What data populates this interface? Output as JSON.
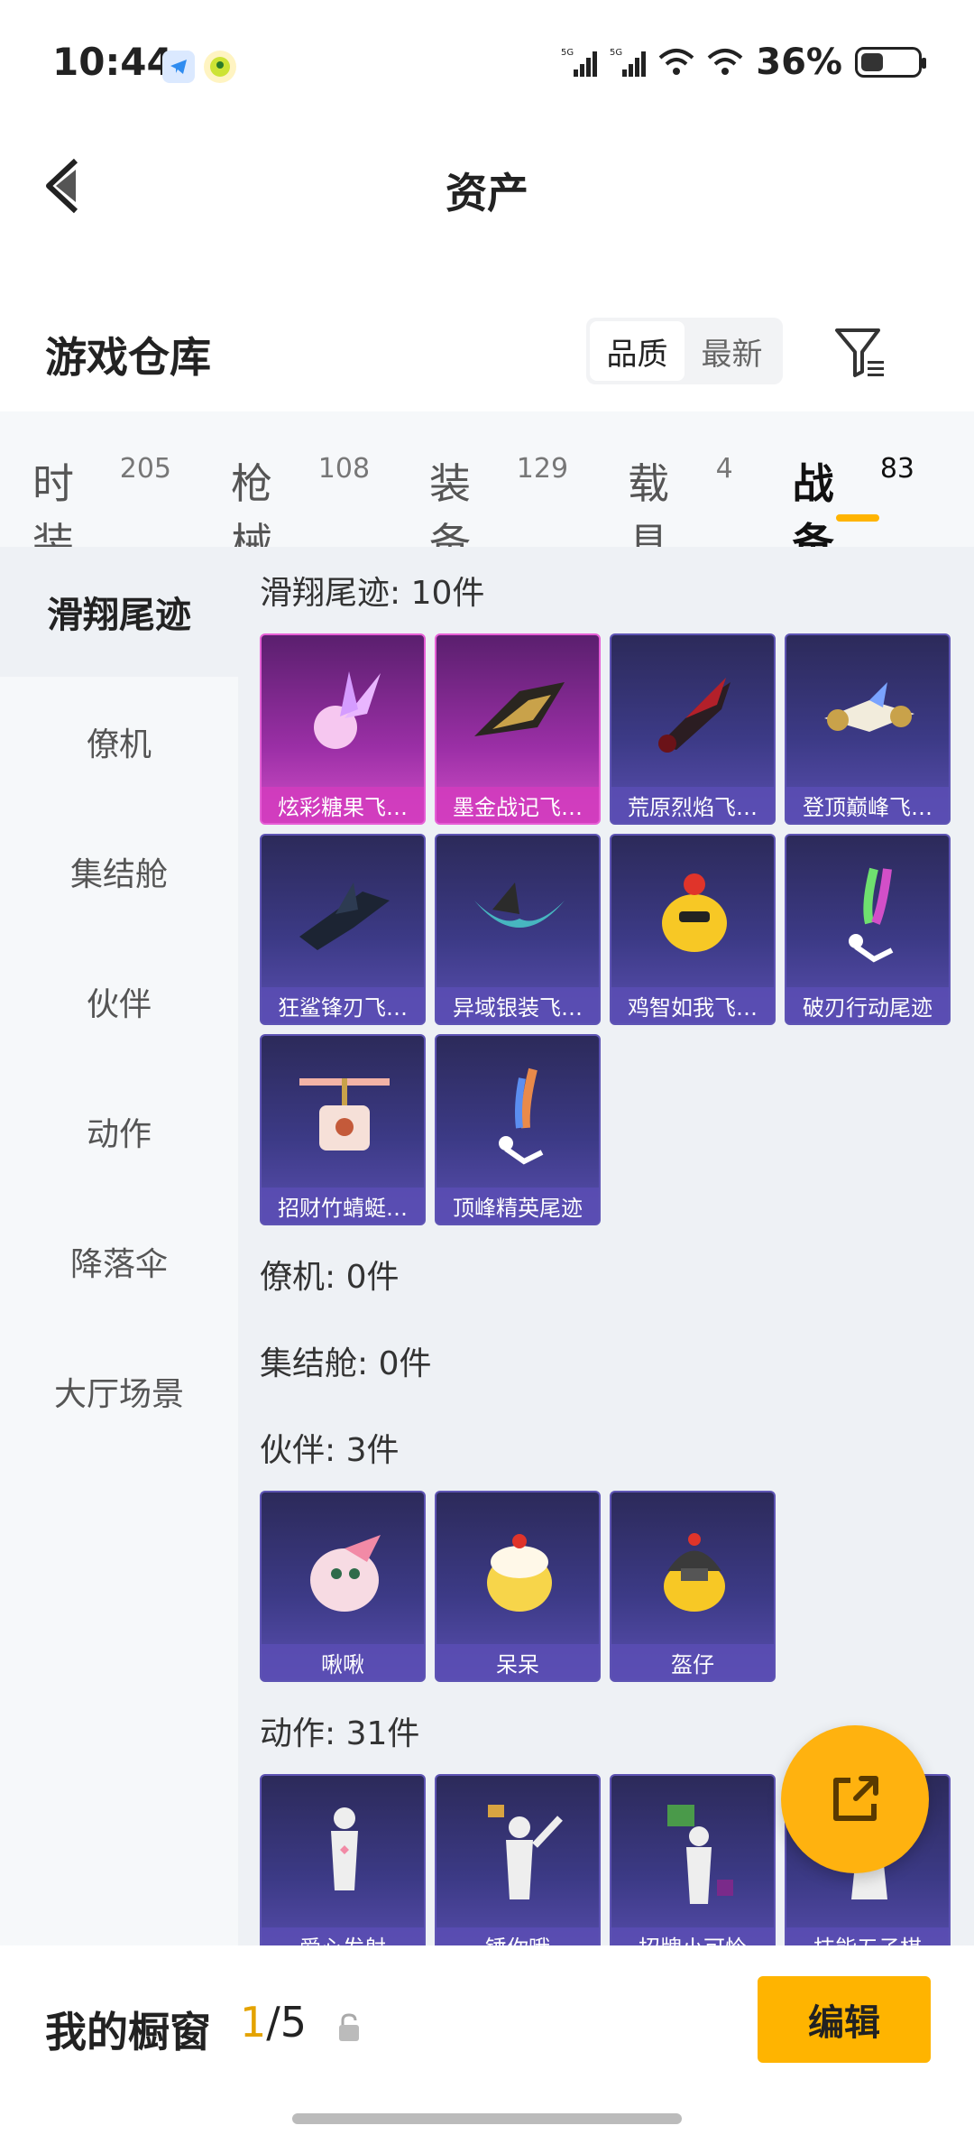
{
  "status": {
    "time": "10:44",
    "battery": "36%",
    "net1": "5G",
    "net2": "5G"
  },
  "header": {
    "title": "资产"
  },
  "warehouse": {
    "title": "游戏仓库",
    "sort_options": [
      "品质",
      "最新"
    ],
    "active_sort": "品质"
  },
  "tabs": [
    {
      "label": "时装",
      "count": "205"
    },
    {
      "label": "枪械",
      "count": "108"
    },
    {
      "label": "装备",
      "count": "129"
    },
    {
      "label": "载具",
      "count": "4"
    },
    {
      "label": "战备",
      "count": "83",
      "active": true
    }
  ],
  "sidebar": [
    "滑翔尾迹",
    "僚机",
    "集结舱",
    "伙伴",
    "动作",
    "降落伞",
    "大厅场景"
  ],
  "sections": {
    "glide": {
      "title": "滑翔尾迹: 10件",
      "items": [
        "炫彩糖果飞…",
        "墨金战记飞…",
        "荒原烈焰飞…",
        "登顶巅峰飞…",
        "狂鲨锋刃飞…",
        "异域银装飞…",
        "鸡智如我飞…",
        "破刃行动尾迹",
        "招财竹蜻蜓…",
        "顶峰精英尾迹"
      ]
    },
    "wingman": {
      "title": "僚机: 0件"
    },
    "pod": {
      "title": "集结舱: 0件"
    },
    "partner": {
      "title": "伙伴: 3件",
      "items": [
        "啾啾",
        "呆呆",
        "盔仔"
      ]
    },
    "action": {
      "title": "动作: 31件",
      "items": [
        "爱心发射",
        "锤你哦",
        "招牌小可怜",
        "技能五子棋"
      ]
    }
  },
  "bottom": {
    "label": "我的橱窗",
    "current": "1",
    "total": "/5",
    "edit": "编辑"
  },
  "colors": {
    "accent": "#ffb400",
    "card_purple": "#3c3a86",
    "card_pink": "#d24fc8"
  }
}
